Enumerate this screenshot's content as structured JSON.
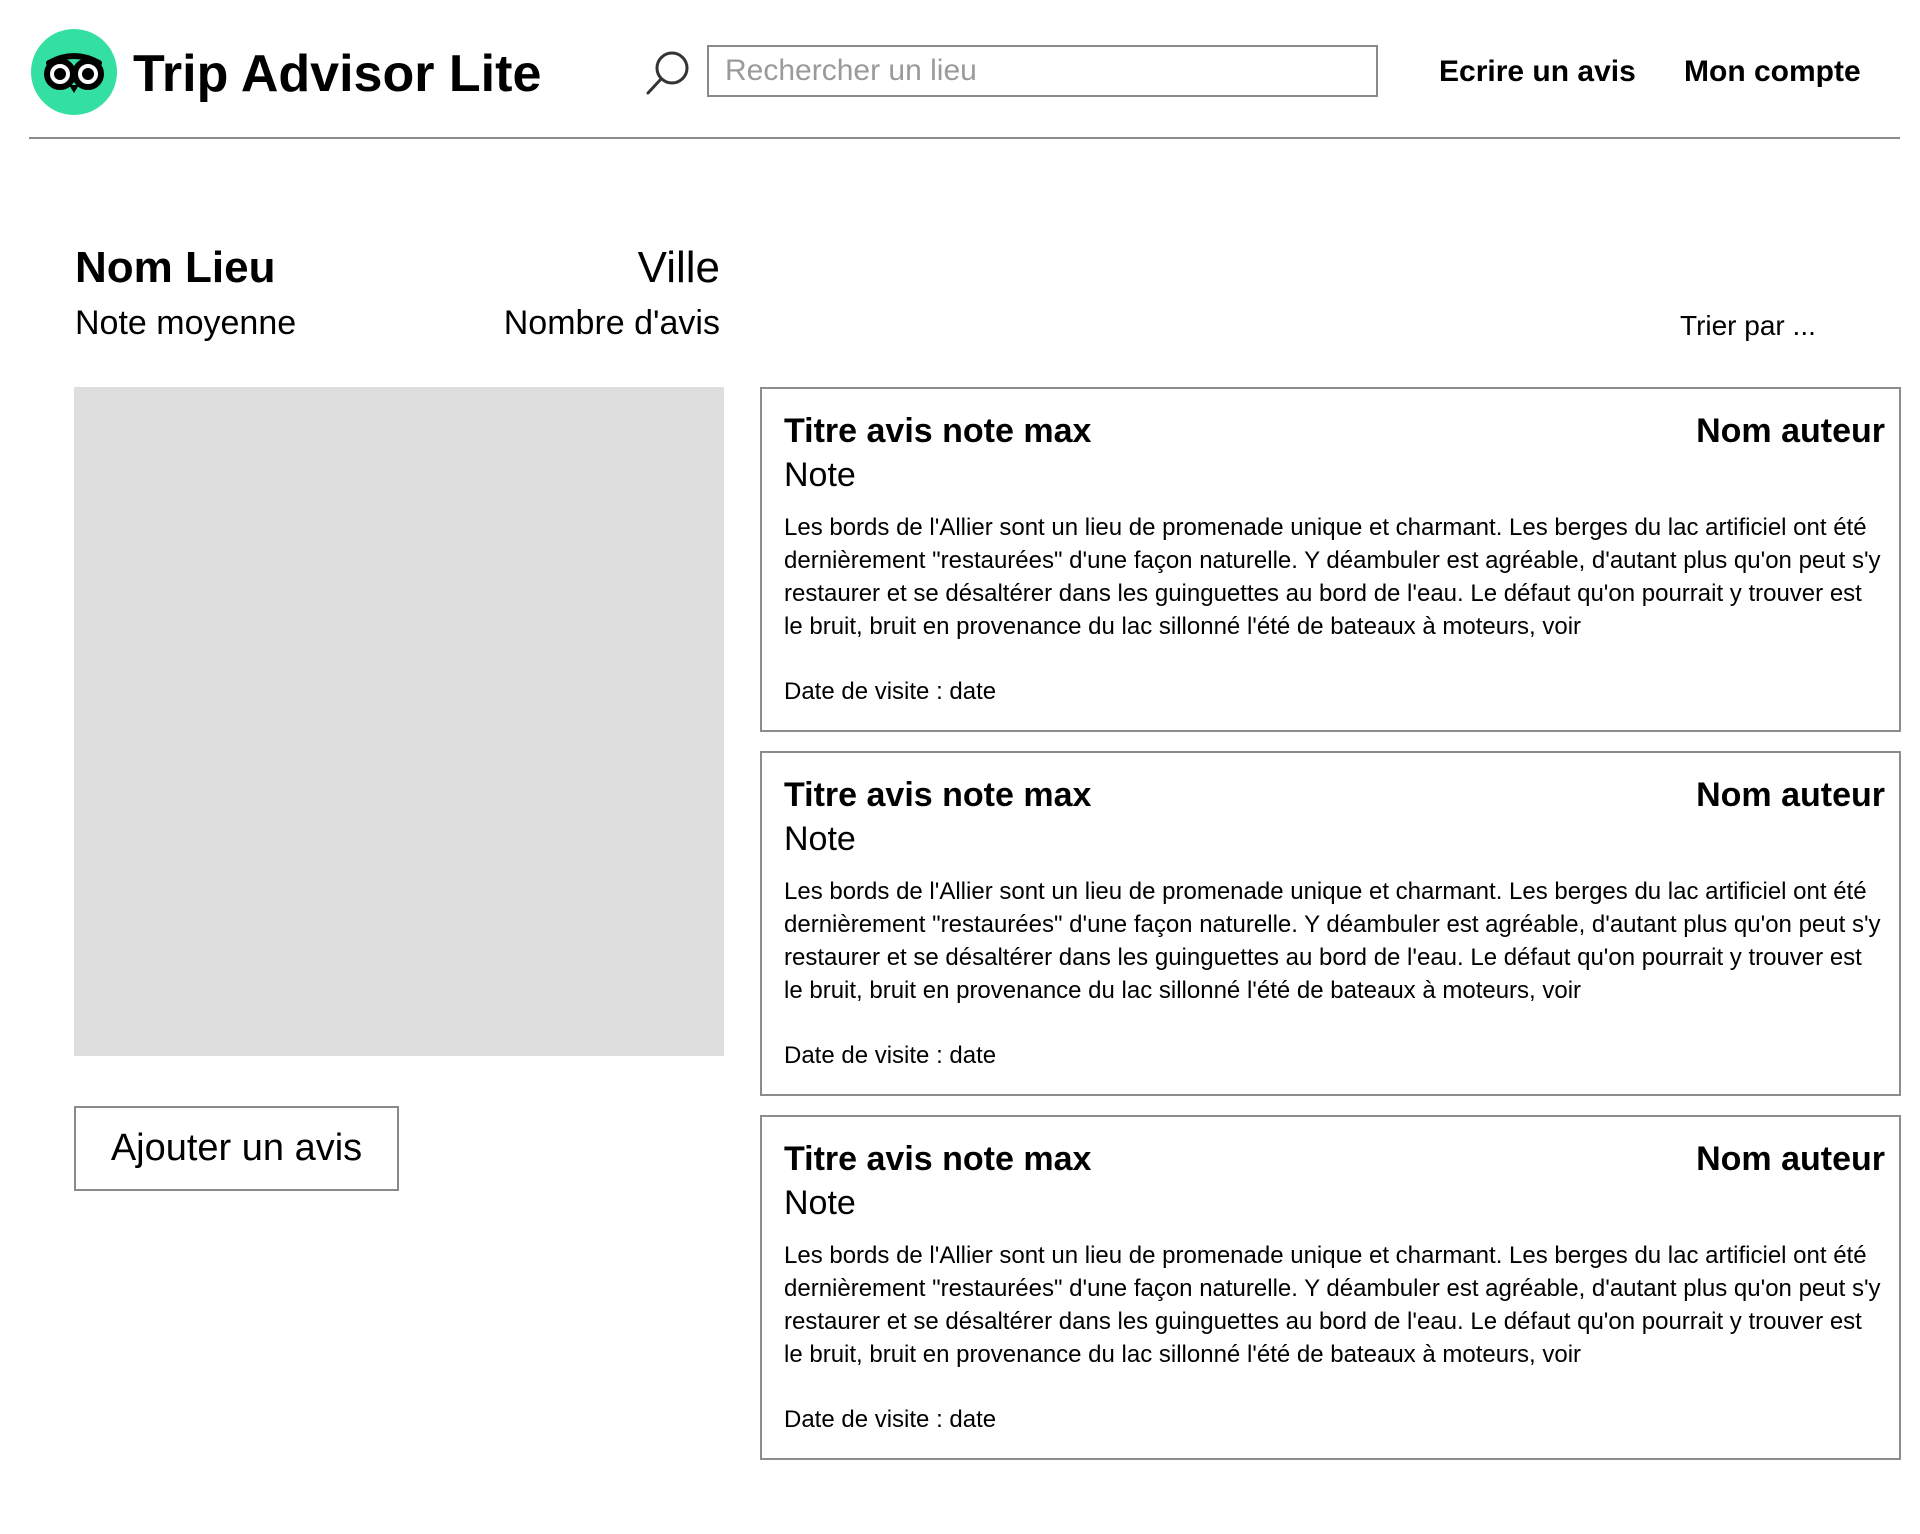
{
  "header": {
    "brand": "Trip Advisor Lite",
    "search_placeholder": "Rechercher un lieu",
    "nav": {
      "write_review": "Ecrire un avis",
      "my_account": "Mon compte"
    },
    "colors": {
      "logo_bg": "#34e0a1"
    },
    "icons": {
      "logo": "owl-eyes-icon",
      "search": "search-icon"
    }
  },
  "place": {
    "name": "Nom Lieu",
    "city": "Ville",
    "average_rating": "Note moyenne",
    "review_count": "Nombre d'avis"
  },
  "sort": {
    "label": "Trier par ..."
  },
  "add_review_label": "Ajouter un avis",
  "reviews": [
    {
      "title": "Titre avis note max",
      "author": "Nom auteur",
      "note": "Note",
      "text": "Les bords de l'Allier sont un lieu de promenade unique et charmant. Les berges du lac artificiel ont été dernièrement \"restaurées\" d'une façon naturelle. Y déambuler est agréable, d'autant plus qu'on peut s'y restaurer et se désaltérer dans les guinguettes au bord de l'eau. Le défaut qu'on pourrait y trouver est le bruit, bruit en provenance du lac sillonné l'été de bateaux à moteurs, voir",
      "date_label": "Date de visite :",
      "date_value": "date"
    },
    {
      "title": "Titre avis note max",
      "author": "Nom auteur",
      "note": "Note",
      "text": "Les bords de l'Allier sont un lieu de promenade unique et charmant. Les berges du lac artificiel ont été dernièrement \"restaurées\" d'une façon naturelle. Y déambuler est agréable, d'autant plus qu'on peut s'y restaurer et se désaltérer dans les guinguettes au bord de l'eau. Le défaut qu'on pourrait y trouver est le bruit, bruit en provenance du lac sillonné l'été de bateaux à moteurs, voir",
      "date_label": "Date de visite :",
      "date_value": "date"
    },
    {
      "title": "Titre avis note max",
      "author": "Nom auteur",
      "note": "Note",
      "text": "Les bords de l'Allier sont un lieu de promenade unique et charmant. Les berges du lac artificiel ont été dernièrement \"restaurées\" d'une façon naturelle. Y déambuler est agréable, d'autant plus qu'on peut s'y restaurer et se désaltérer dans les guinguettes au bord de l'eau. Le défaut qu'on pourrait y trouver est le bruit, bruit en provenance du lac sillonné l'été de bateaux à moteurs, voir",
      "date_label": "Date de visite :",
      "date_value": "date"
    }
  ]
}
